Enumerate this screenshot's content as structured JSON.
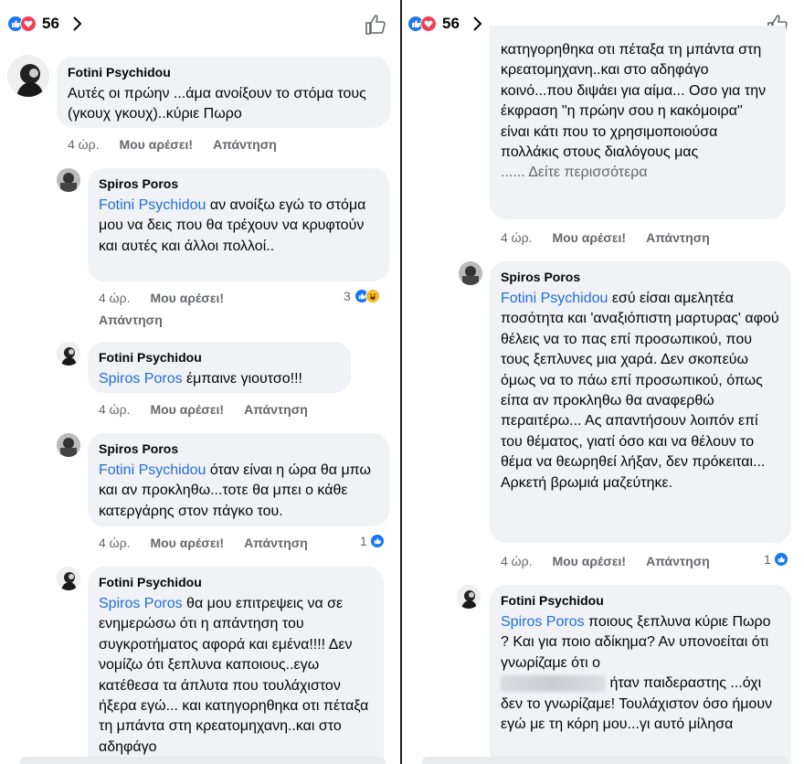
{
  "header": {
    "reaction_count": "56"
  },
  "left": {
    "c1": {
      "author": "Fotini Psychidou",
      "text": "Αυτές οι πρώην ...άμα ανοίξουν το στόμα τους  (γκουχ γκουχ)..κύριε Πωρο",
      "time": "4 ώρ.",
      "like": "Μου αρέσει!",
      "reply": "Απάντηση"
    },
    "c2": {
      "author": "Spiros Poros",
      "mention": "Fotini Psychidou",
      "text": " αν ανοίξω εγώ το στόμα μου να δεις που θα τρέχουν να κρυφτούν και αυτές και  άλλοι πολλοί..",
      "time": "4 ώρ.",
      "like": "Μου αρέσει!",
      "reply": "Απάντηση",
      "reactions": "3"
    },
    "c3": {
      "author": "Fotini Psychidou",
      "mention": "Spiros Poros",
      "text": " έμπαινε γιουτσο!!!",
      "time": "4 ώρ.",
      "like": "Μου αρέσει!",
      "reply": "Απάντηση"
    },
    "c4": {
      "author": "Spiros Poros",
      "mention": "Fotini Psychidou",
      "text": " όταν είναι η ώρα θα μπω και αν προκληθω...τοτε θα μπει ο κάθε κατεργάρης στον πάγκο του.",
      "time": "4 ώρ.",
      "like": "Μου αρέσει!",
      "reply": "Απάντηση",
      "reactions": "1"
    },
    "c5": {
      "author": "Fotini Psychidou",
      "mention": "Spiros Poros",
      "text": " θα μου επιτρεψεις να σε ενημερώσω ότι η απάντηση του συγκροτήματος αφορά και εμένα!!!! Δεν νομίζω ότι ξεπλυνα καποιους..εγω κατέθεσα τα άπλυτα που τουλάχιστον ήξερα εγώ... και κατηγορηθηκα οτι πέταξα τη μπάντα στη κρεατομηχανη..και στο αδηφάγο"
    }
  },
  "right": {
    "c1": {
      "text": "κατηγορηθηκα οτι πέταξα τη μπάντα στη κρεατομηχανη..και στο αδηφάγο κοινό...που διψάει για αίμα... Οσο για την έκφραση \"η πρώην σου η κακόμοιρα\" είναι κάτι που το χρησιμοποιούσα πολλάκις στους διαλόγους μας",
      "more": "...... Δείτε περισσότερα",
      "time": "4 ώρ.",
      "like": "Μου αρέσει!",
      "reply": "Απάντηση"
    },
    "c2": {
      "author": "Spiros Poros",
      "mention": "Fotini Psychidou",
      "text": " εσύ είσαι αμελητέα ποσότητα και 'αναξιόπιστη μαρτυρας' αφού θέλεις να το πας επί προσωπικού, που τους ξεπλυνες μια χαρά. Δεν σκοπεύω όμως να το πάω επί προσωπικού, όπως είπα αν προκληθω θα αναφερθώ περαιτέρω... Ας απαντήσουν λοιπόν επί του θέματος, γιατί όσο και να θέλουν το θέμα να θεωρηθεί λήξαν, δεν πρόκειται... Αρκετή βρωμιά μαζεύτηκε.",
      "time": "4 ώρ.",
      "like": "Μου αρέσει!",
      "reply": "Απάντηση",
      "reactions": "1"
    },
    "c3": {
      "author": "Fotini Psychidou",
      "mention": "Spiros Poros",
      "text1": " ποιους ξεπλυνα κύριε Πωρο ? Και για ποιο αδίκημα? Αν υπονοείται ότι γνωρίζαμε ότι ο",
      "text2": " ήταν παιδεραστης ...όχι δεν το γνωρίζαμε! Τουλάχιστον όσο ήμουν εγώ με τη κόρη μου...γι αυτό μίλησα"
    }
  }
}
